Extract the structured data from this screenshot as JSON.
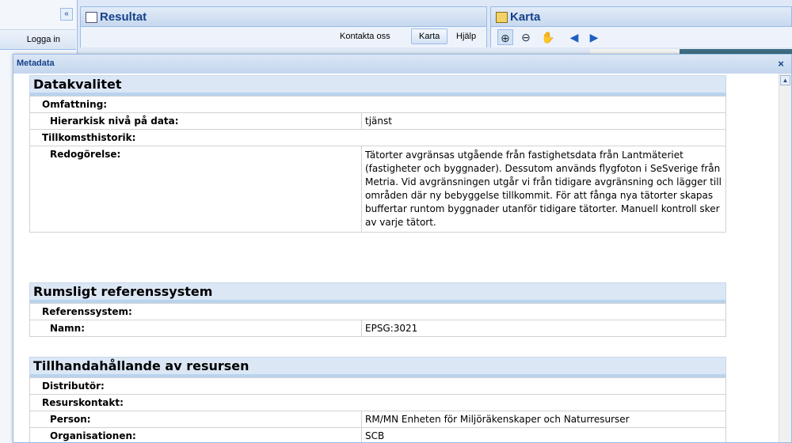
{
  "app": {
    "left": {
      "collapse_glyph": "«",
      "login_label": "Logga in"
    },
    "resultat": {
      "title": "Resultat",
      "contact_label": "Kontakta oss",
      "map_label": "Karta",
      "help_label": "Hjälp"
    },
    "karta": {
      "title": "Karta"
    }
  },
  "metadata": {
    "title": "Metadata",
    "close_glyph": "×",
    "sections": {
      "datakvalitet": {
        "title": "Datakvalitet",
        "omfattning": "Omfattning:",
        "hierarkisk_label": "Hierarkisk nivå på data:",
        "hierarkisk_value": "tjänst",
        "tillkomst": "Tillkomsthistorik:",
        "redogorelse_label": "Redogörelse:",
        "redogorelse_value": "Tätorter avgränsas utgående från fastighetsdata från Lantmäteriet (fastigheter och byggnader). Dessutom används flygfoton i SeSverige från Metria. Vid avgränsningen utgår vi från tidigare avgränsning och lägger till områden där ny bebyggelse tillkommit. För att fånga nya tätorter skapas buffertar runtom byggnader utanför tidigare tätorter. Manuell kontroll sker av varje tätort."
      },
      "rumsligt": {
        "title": "Rumsligt referenssystem",
        "referens_label": "Referenssystem:",
        "namn_label": "Namn:",
        "namn_value": "EPSG:3021"
      },
      "tillhanda": {
        "title": "Tillhandahållande av resursen",
        "distributor": "Distributör:",
        "resurskontakt": "Resurskontakt:",
        "person_label": "Person:",
        "person_value": "RM/MN Enheten för Miljöräkenskaper och Naturresurser",
        "org_label": "Organisationen:",
        "org_value": "SCB"
      }
    }
  }
}
